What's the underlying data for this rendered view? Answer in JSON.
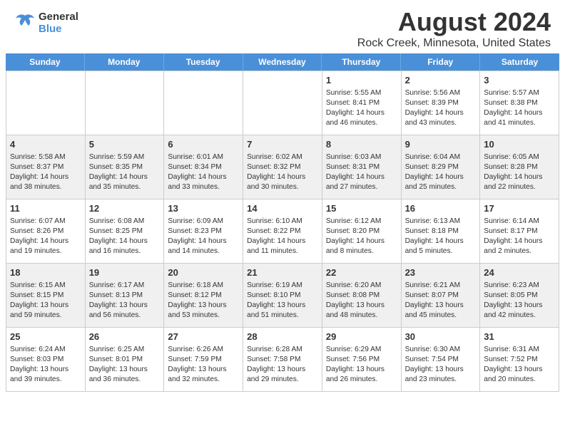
{
  "header": {
    "title": "August 2024",
    "subtitle": "Rock Creek, Minnesota, United States",
    "logo_general": "General",
    "logo_blue": "Blue"
  },
  "calendar": {
    "days_of_week": [
      "Sunday",
      "Monday",
      "Tuesday",
      "Wednesday",
      "Thursday",
      "Friday",
      "Saturday"
    ],
    "rows": [
      [
        {
          "day": "",
          "info": ""
        },
        {
          "day": "",
          "info": ""
        },
        {
          "day": "",
          "info": ""
        },
        {
          "day": "",
          "info": ""
        },
        {
          "day": "1",
          "info": "Sunrise: 5:55 AM\nSunset: 8:41 PM\nDaylight: 14 hours and 46 minutes."
        },
        {
          "day": "2",
          "info": "Sunrise: 5:56 AM\nSunset: 8:39 PM\nDaylight: 14 hours and 43 minutes."
        },
        {
          "day": "3",
          "info": "Sunrise: 5:57 AM\nSunset: 8:38 PM\nDaylight: 14 hours and 41 minutes."
        }
      ],
      [
        {
          "day": "4",
          "info": "Sunrise: 5:58 AM\nSunset: 8:37 PM\nDaylight: 14 hours and 38 minutes."
        },
        {
          "day": "5",
          "info": "Sunrise: 5:59 AM\nSunset: 8:35 PM\nDaylight: 14 hours and 35 minutes."
        },
        {
          "day": "6",
          "info": "Sunrise: 6:01 AM\nSunset: 8:34 PM\nDaylight: 14 hours and 33 minutes."
        },
        {
          "day": "7",
          "info": "Sunrise: 6:02 AM\nSunset: 8:32 PM\nDaylight: 14 hours and 30 minutes."
        },
        {
          "day": "8",
          "info": "Sunrise: 6:03 AM\nSunset: 8:31 PM\nDaylight: 14 hours and 27 minutes."
        },
        {
          "day": "9",
          "info": "Sunrise: 6:04 AM\nSunset: 8:29 PM\nDaylight: 14 hours and 25 minutes."
        },
        {
          "day": "10",
          "info": "Sunrise: 6:05 AM\nSunset: 8:28 PM\nDaylight: 14 hours and 22 minutes."
        }
      ],
      [
        {
          "day": "11",
          "info": "Sunrise: 6:07 AM\nSunset: 8:26 PM\nDaylight: 14 hours and 19 minutes."
        },
        {
          "day": "12",
          "info": "Sunrise: 6:08 AM\nSunset: 8:25 PM\nDaylight: 14 hours and 16 minutes."
        },
        {
          "day": "13",
          "info": "Sunrise: 6:09 AM\nSunset: 8:23 PM\nDaylight: 14 hours and 14 minutes."
        },
        {
          "day": "14",
          "info": "Sunrise: 6:10 AM\nSunset: 8:22 PM\nDaylight: 14 hours and 11 minutes."
        },
        {
          "day": "15",
          "info": "Sunrise: 6:12 AM\nSunset: 8:20 PM\nDaylight: 14 hours and 8 minutes."
        },
        {
          "day": "16",
          "info": "Sunrise: 6:13 AM\nSunset: 8:18 PM\nDaylight: 14 hours and 5 minutes."
        },
        {
          "day": "17",
          "info": "Sunrise: 6:14 AM\nSunset: 8:17 PM\nDaylight: 14 hours and 2 minutes."
        }
      ],
      [
        {
          "day": "18",
          "info": "Sunrise: 6:15 AM\nSunset: 8:15 PM\nDaylight: 13 hours and 59 minutes."
        },
        {
          "day": "19",
          "info": "Sunrise: 6:17 AM\nSunset: 8:13 PM\nDaylight: 13 hours and 56 minutes."
        },
        {
          "day": "20",
          "info": "Sunrise: 6:18 AM\nSunset: 8:12 PM\nDaylight: 13 hours and 53 minutes."
        },
        {
          "day": "21",
          "info": "Sunrise: 6:19 AM\nSunset: 8:10 PM\nDaylight: 13 hours and 51 minutes."
        },
        {
          "day": "22",
          "info": "Sunrise: 6:20 AM\nSunset: 8:08 PM\nDaylight: 13 hours and 48 minutes."
        },
        {
          "day": "23",
          "info": "Sunrise: 6:21 AM\nSunset: 8:07 PM\nDaylight: 13 hours and 45 minutes."
        },
        {
          "day": "24",
          "info": "Sunrise: 6:23 AM\nSunset: 8:05 PM\nDaylight: 13 hours and 42 minutes."
        }
      ],
      [
        {
          "day": "25",
          "info": "Sunrise: 6:24 AM\nSunset: 8:03 PM\nDaylight: 13 hours and 39 minutes."
        },
        {
          "day": "26",
          "info": "Sunrise: 6:25 AM\nSunset: 8:01 PM\nDaylight: 13 hours and 36 minutes."
        },
        {
          "day": "27",
          "info": "Sunrise: 6:26 AM\nSunset: 7:59 PM\nDaylight: 13 hours and 32 minutes."
        },
        {
          "day": "28",
          "info": "Sunrise: 6:28 AM\nSunset: 7:58 PM\nDaylight: 13 hours and 29 minutes."
        },
        {
          "day": "29",
          "info": "Sunrise: 6:29 AM\nSunset: 7:56 PM\nDaylight: 13 hours and 26 minutes."
        },
        {
          "day": "30",
          "info": "Sunrise: 6:30 AM\nSunset: 7:54 PM\nDaylight: 13 hours and 23 minutes."
        },
        {
          "day": "31",
          "info": "Sunrise: 6:31 AM\nSunset: 7:52 PM\nDaylight: 13 hours and 20 minutes."
        }
      ]
    ]
  }
}
